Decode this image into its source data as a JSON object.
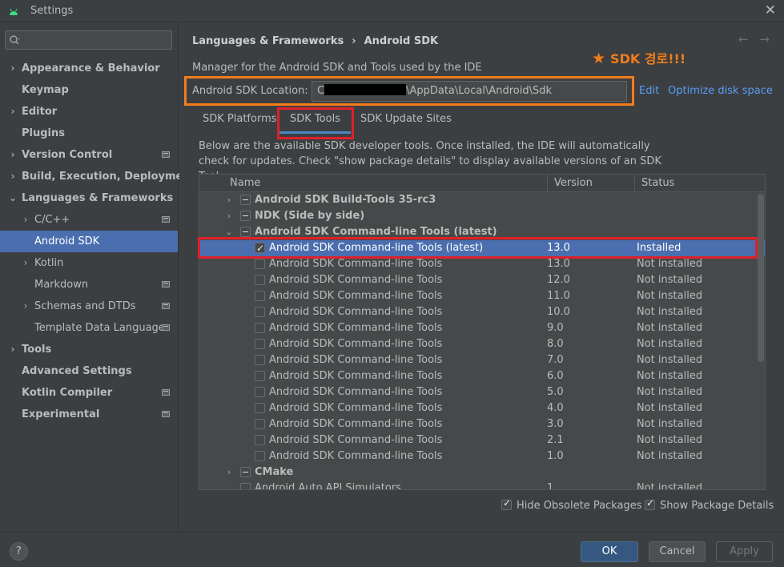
{
  "window": {
    "title": "Settings"
  },
  "sidebar": {
    "search_placeholder": "",
    "items": [
      {
        "label": "Appearance & Behavior",
        "expanded": false,
        "bold": true
      },
      {
        "label": "Keymap",
        "bold": true
      },
      {
        "label": "Editor",
        "expanded": false,
        "bold": true
      },
      {
        "label": "Plugins",
        "bold": true
      },
      {
        "label": "Version Control",
        "expanded": false,
        "bold": true
      },
      {
        "label": "Build, Execution, Deployment",
        "expanded": false,
        "bold": true
      },
      {
        "label": "Languages & Frameworks",
        "expanded": true,
        "bold": true
      },
      {
        "label": "C/C++",
        "expanded": false
      },
      {
        "label": "Android SDK",
        "selected": true
      },
      {
        "label": "Kotlin",
        "expanded": false
      },
      {
        "label": "Markdown"
      },
      {
        "label": "Schemas and DTDs",
        "expanded": false
      },
      {
        "label": "Template Data Languages"
      },
      {
        "label": "Tools",
        "expanded": false,
        "bold": true
      },
      {
        "label": "Advanced Settings",
        "bold": true
      },
      {
        "label": "Kotlin Compiler",
        "bold": true
      },
      {
        "label": "Experimental",
        "bold": true
      }
    ]
  },
  "breadcrumb": {
    "parent": "Languages & Frameworks",
    "separator": "›",
    "current": "Android SDK"
  },
  "nav": {
    "back": "←",
    "forward": "→"
  },
  "description": "Manager for the Android SDK and Tools used by the IDE",
  "annotation": {
    "star": "★",
    "text": "SDK 경로!!!"
  },
  "sdk_location": {
    "label": "Android SDK Location:",
    "value_prefix": "C",
    "value_suffix": "\\AppData\\Local\\Android\\Sdk",
    "edit": "Edit",
    "optimize": "Optimize disk space"
  },
  "tabs": [
    {
      "label": "SDK Platforms",
      "selected": false
    },
    {
      "label": "SDK Tools",
      "selected": true
    },
    {
      "label": "SDK Update Sites",
      "selected": false
    }
  ],
  "tools_description": "Below are the available SDK developer tools. Once installed, the IDE will automatically check for updates. Check \"show package details\" to display available versions of an SDK Tool.",
  "table": {
    "columns": [
      "Name",
      "Version",
      "Status"
    ],
    "rows": [
      {
        "type": "group",
        "expanded": false,
        "name": "Android SDK Build-Tools 35-rc3",
        "version": "",
        "status": ""
      },
      {
        "type": "group",
        "expanded": false,
        "name": "NDK (Side by side)",
        "version": "",
        "status": ""
      },
      {
        "type": "group",
        "expanded": true,
        "name": "Android SDK Command-line Tools (latest)",
        "version": "",
        "status": ""
      },
      {
        "type": "child",
        "checked": true,
        "selected": true,
        "name": "Android SDK Command-line Tools (latest)",
        "version": "13.0",
        "status": "Installed"
      },
      {
        "type": "child",
        "checked": false,
        "name": "Android SDK Command-line Tools",
        "version": "13.0",
        "status": "Not installed"
      },
      {
        "type": "child",
        "checked": false,
        "name": "Android SDK Command-line Tools",
        "version": "12.0",
        "status": "Not installed"
      },
      {
        "type": "child",
        "checked": false,
        "name": "Android SDK Command-line Tools",
        "version": "11.0",
        "status": "Not installed"
      },
      {
        "type": "child",
        "checked": false,
        "name": "Android SDK Command-line Tools",
        "version": "10.0",
        "status": "Not installed"
      },
      {
        "type": "child",
        "checked": false,
        "name": "Android SDK Command-line Tools",
        "version": "9.0",
        "status": "Not installed"
      },
      {
        "type": "child",
        "checked": false,
        "name": "Android SDK Command-line Tools",
        "version": "8.0",
        "status": "Not installed"
      },
      {
        "type": "child",
        "checked": false,
        "name": "Android SDK Command-line Tools",
        "version": "7.0",
        "status": "Not installed"
      },
      {
        "type": "child",
        "checked": false,
        "name": "Android SDK Command-line Tools",
        "version": "6.0",
        "status": "Not installed"
      },
      {
        "type": "child",
        "checked": false,
        "name": "Android SDK Command-line Tools",
        "version": "5.0",
        "status": "Not installed"
      },
      {
        "type": "child",
        "checked": false,
        "name": "Android SDK Command-line Tools",
        "version": "4.0",
        "status": "Not installed"
      },
      {
        "type": "child",
        "checked": false,
        "name": "Android SDK Command-line Tools",
        "version": "3.0",
        "status": "Not installed"
      },
      {
        "type": "child",
        "checked": false,
        "name": "Android SDK Command-line Tools",
        "version": "2.1",
        "status": "Not installed"
      },
      {
        "type": "child",
        "checked": false,
        "name": "Android SDK Command-line Tools",
        "version": "1.0",
        "status": "Not installed"
      },
      {
        "type": "group",
        "expanded": false,
        "name": "CMake",
        "version": "",
        "status": ""
      },
      {
        "type": "item",
        "checked": false,
        "name": "Android Auto API Simulators",
        "version": "1",
        "status": "Not installed"
      }
    ]
  },
  "options": {
    "hide_obsolete": {
      "label": "Hide Obsolete Packages",
      "checked": true
    },
    "show_details": {
      "label": "Show Package Details",
      "checked": true
    }
  },
  "buttons": {
    "help": "?",
    "ok": "OK",
    "cancel": "Cancel",
    "apply": "Apply"
  },
  "colors": {
    "accent": "#4b6eaf",
    "link": "#589df6",
    "annotation_orange": "#f47c1b",
    "annotation_red": "#e0202a"
  }
}
